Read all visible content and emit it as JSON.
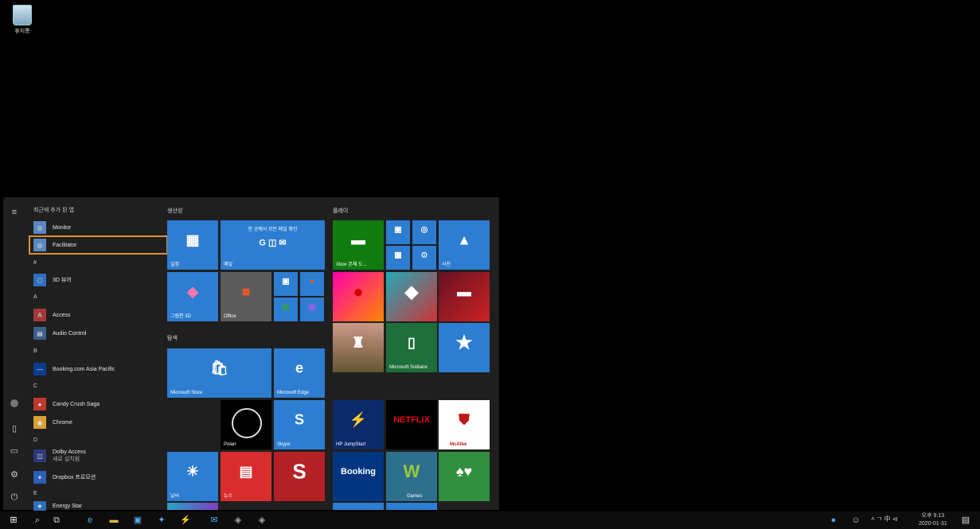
{
  "desktop": {
    "recycle_bin_label": "휴지통"
  },
  "start_menu": {
    "recent_header": "최근에 추가 된 앱",
    "recent_apps": [
      "Monitor",
      "Facilitator"
    ],
    "sections": [
      {
        "letter": "#",
        "apps": [
          "3D 뷰어"
        ]
      },
      {
        "letter": "A",
        "apps": [
          "Access",
          "Audio Control"
        ]
      },
      {
        "letter": "B",
        "apps": [
          "Booking.com Asia Pacific"
        ]
      },
      {
        "letter": "C",
        "apps": [
          "Candy Crush Saga",
          "Chrome"
        ]
      },
      {
        "letter": "D",
        "apps": [
          "Dolby Access",
          "Dropbox 프로모션"
        ]
      },
      {
        "letter": "E",
        "apps": [
          "Energy Star"
        ]
      }
    ],
    "dolby_sub": "새로 설치됨",
    "groups": {
      "productivity": "생산성",
      "explore": "탐색",
      "play": "플레이"
    },
    "tiles": {
      "calendar": "일정",
      "mail_banner": "한 곳에서 모든 메일 확인",
      "mail": "메일",
      "paint3d": "그림판 3D",
      "office": "Office",
      "store": "Microsoft Store",
      "edge": "Microsoft Edge",
      "photos": "사진",
      "xbox": "Xbox 본체 도...",
      "solitaire": "Microsoft Solitaire",
      "polarr": "Polarr",
      "skype": "Skype",
      "weather": "날씨",
      "news": "뉴스",
      "hp_jumpstart": "HP JumpStart",
      "netflix": "NETFLIX",
      "mcafee": "McAfee",
      "booking": "Booking",
      "games": "Games"
    }
  },
  "taskbar": {
    "clock_time": "오후 9:13",
    "clock_date": "2020-01-31",
    "tray_text": "˄ ㄱ 中 ⊲"
  }
}
